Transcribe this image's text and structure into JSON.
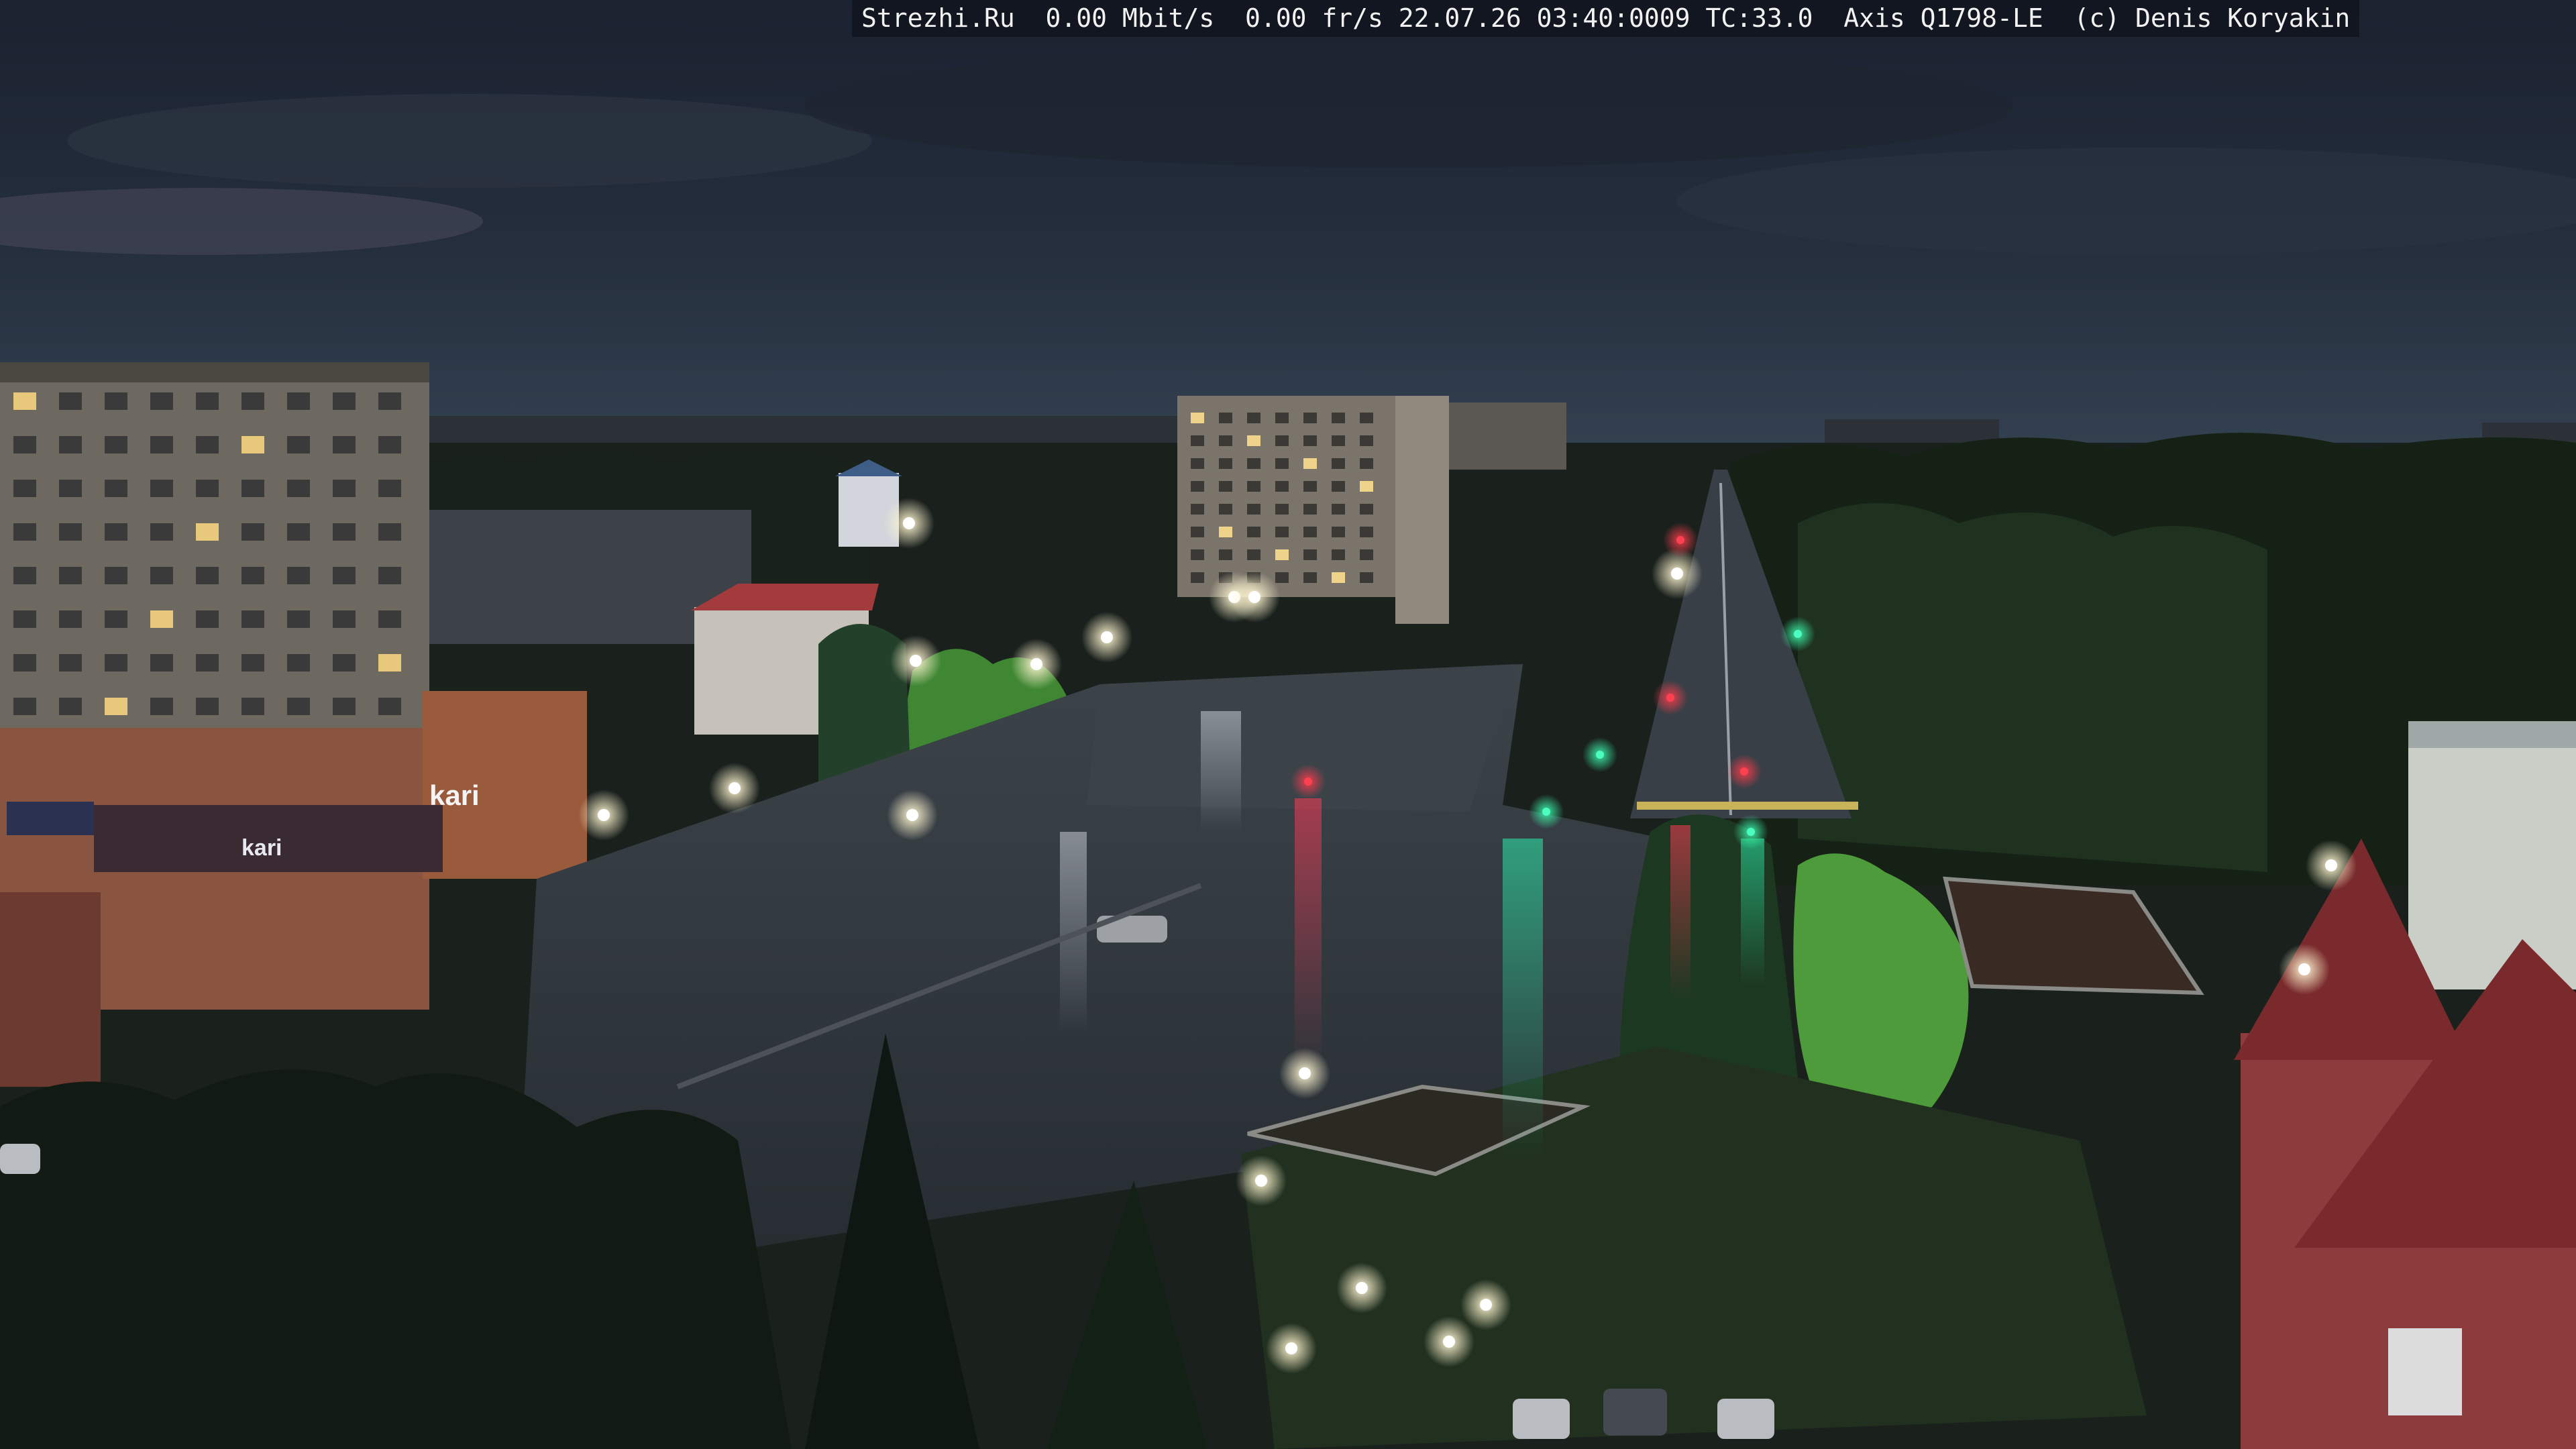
{
  "camera_overlay": {
    "site": "Strezhi.Ru",
    "bitrate": "0.00 Mbit/s",
    "framerate": "0.00 fr/s",
    "timestamp": "22.07.26 03:40:0009",
    "tc": "TC:33.0",
    "camera_model": "Axis Q1798-LE",
    "copyright": "(c) Denis Koryakin"
  },
  "signage": {
    "store_sign": "kari",
    "store_sign_small": "kari"
  },
  "colors": {
    "sky_top": "#1c2331",
    "sky_horizon": "#2d3a4a",
    "tree_dark": "#141c14",
    "tree_lit": "#4ea53a",
    "asphalt_wet": "#2b3238",
    "lamp_glow": "#fff6d8",
    "traffic_red": "#ff2a3a",
    "traffic_green": "#27f29a"
  }
}
